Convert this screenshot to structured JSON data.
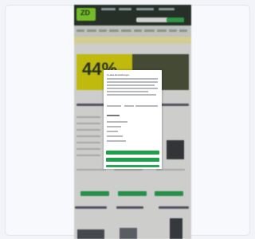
{
  "banner": {
    "percent": "44%"
  },
  "modal": {
    "title": "Cookie-Einstellungen"
  },
  "colors": {
    "brand_green": "#1e9f4a",
    "logo_green": "#7cd320",
    "banner_yellow": "#d9d200"
  }
}
